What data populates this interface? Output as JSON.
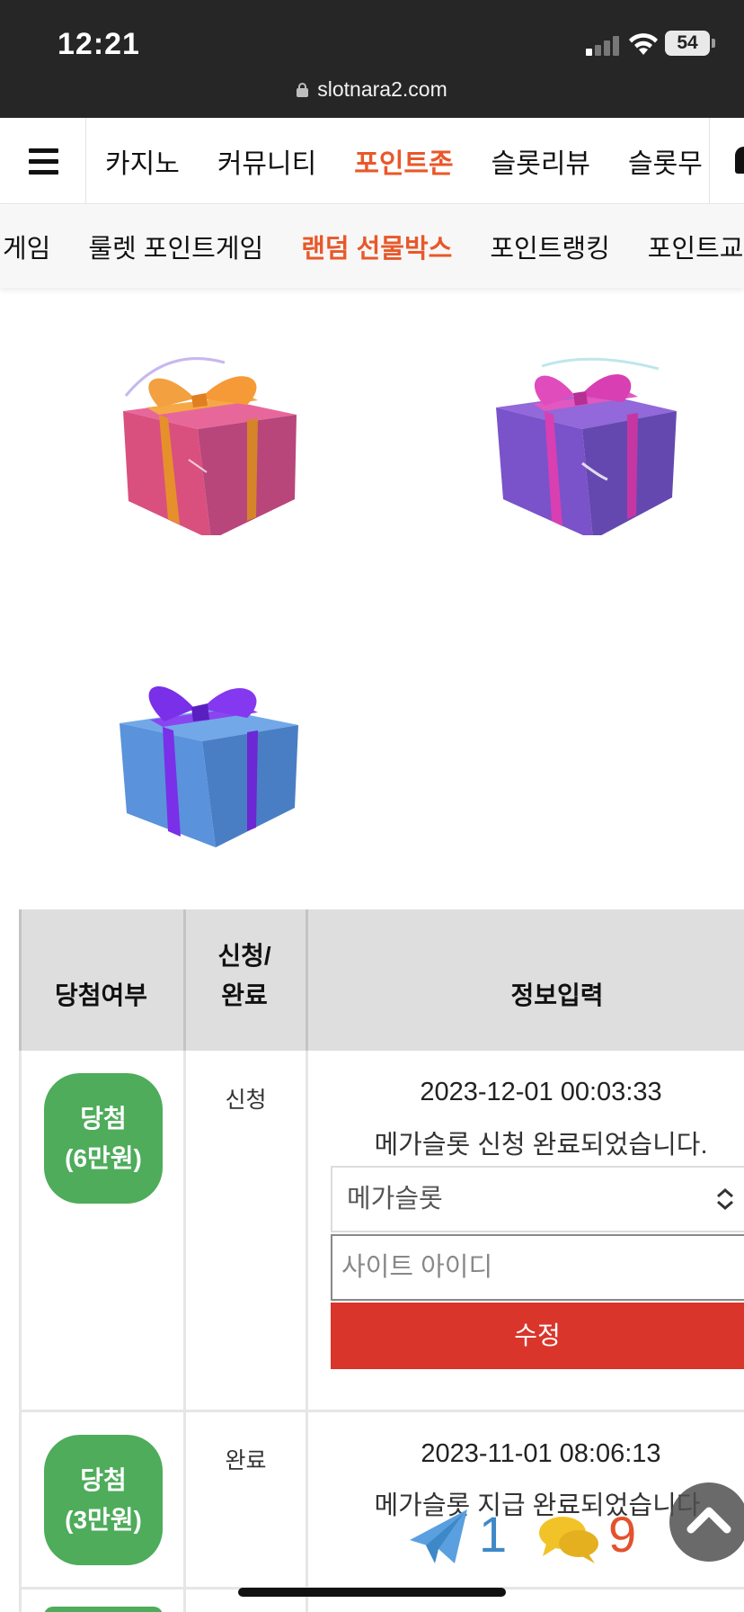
{
  "status_bar": {
    "time": "12:21",
    "battery": "54"
  },
  "browser": {
    "url": "slotnara2.com"
  },
  "main_nav": {
    "items": [
      {
        "label": "카지노",
        "active": false
      },
      {
        "label": "커뮤니티",
        "active": false
      },
      {
        "label": "포인트존",
        "active": true
      },
      {
        "label": "슬롯리뷰",
        "active": false
      },
      {
        "label": "슬롯무",
        "active": false
      }
    ]
  },
  "sub_nav": {
    "items": [
      {
        "label": "게임",
        "active": false
      },
      {
        "label": "룰렛 포인트게임",
        "active": false
      },
      {
        "label": "랜덤 선물박스",
        "active": true
      },
      {
        "label": "포인트랭킹",
        "active": false
      },
      {
        "label": "포인트교",
        "active": false
      }
    ]
  },
  "gift_boxes": [
    {
      "color": "pink",
      "body": "#d9507f",
      "ribbon": "#f1922f"
    },
    {
      "color": "purple",
      "body": "#7a52c9",
      "ribbon": "#d83fb2"
    },
    {
      "color": "blue",
      "body": "#5a92dc",
      "ribbon": "#7a2fe8"
    }
  ],
  "table": {
    "headers": {
      "result": "당첨여부",
      "status": "신청/\n완료",
      "info": "정보입력"
    },
    "rows": [
      {
        "badge_line1": "당첨",
        "badge_line2": "(6만원)",
        "status": "신청",
        "date": "2023-12-01 00:03:33",
        "message": "메가슬롯 신청 완료되었습니다.",
        "select_value": "메가슬롯",
        "input_placeholder": "사이트 아이디",
        "button_label": "수정"
      },
      {
        "badge_line1": "당첨",
        "badge_line2": "(3만원)",
        "status": "완료",
        "date": "2023-11-01 08:06:13",
        "message": "메가슬롯 지급 완료되었습니다."
      }
    ]
  },
  "floating": {
    "telegram_count": "1",
    "chat_count": "9"
  },
  "colors": {
    "accent": "#e8582a",
    "badge_green": "#4eac5b",
    "button_red": "#d9352b",
    "header_gray": "#dedede"
  }
}
